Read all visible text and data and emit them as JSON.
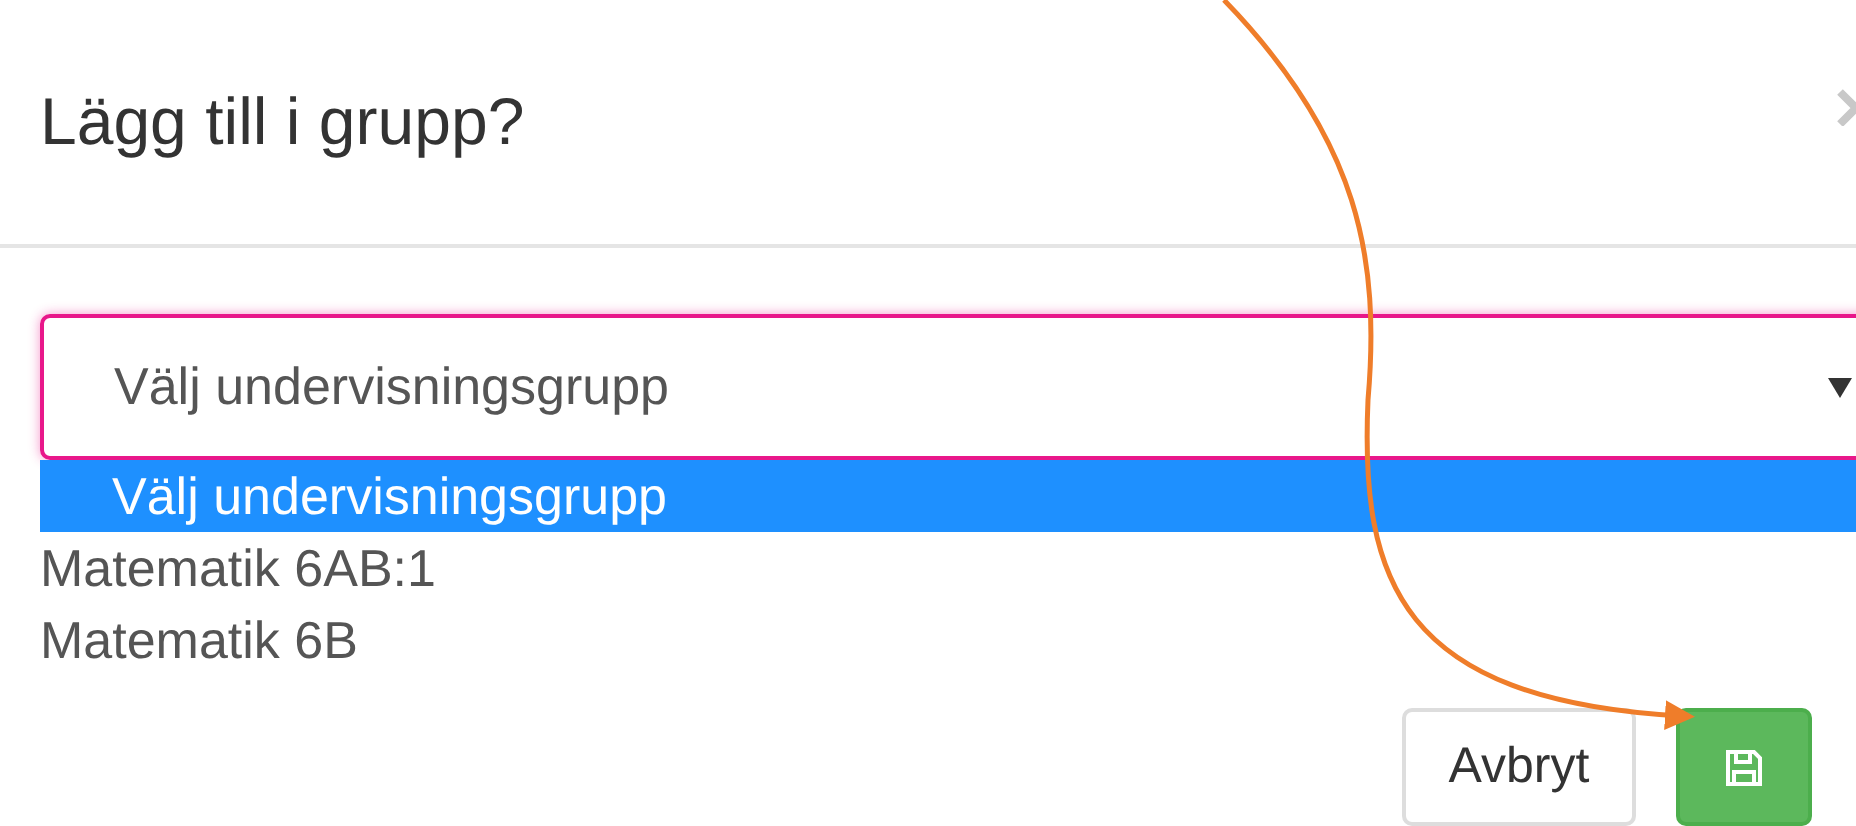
{
  "dialog": {
    "title": "Lägg till i grupp?"
  },
  "select": {
    "value": "Välj undervisningsgrupp",
    "open": true
  },
  "options": [
    {
      "label": "Välj undervisningsgrupp",
      "selected": true
    },
    {
      "label": "Matematik 6AB:1",
      "selected": false
    },
    {
      "label": "Matematik 6B",
      "selected": false
    }
  ],
  "buttons": [
    {
      "kind": "text",
      "label": "Avbryt"
    },
    {
      "kind": "save"
    }
  ]
}
